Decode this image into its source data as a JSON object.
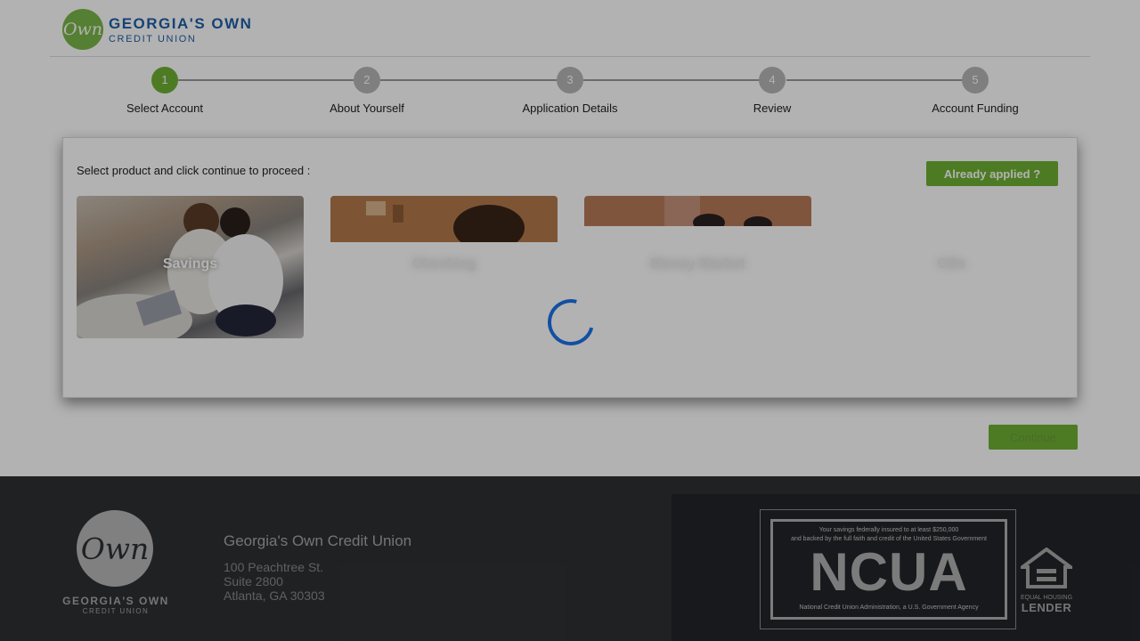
{
  "header": {
    "logo_mark": "Own",
    "logo_line1": "GEORGIA'S OWN",
    "logo_line2": "CREDIT UNION"
  },
  "steps": [
    {
      "num": "1",
      "label": "Select Account",
      "active": true
    },
    {
      "num": "2",
      "label": "About Yourself",
      "active": false
    },
    {
      "num": "3",
      "label": "Application Details",
      "active": false
    },
    {
      "num": "4",
      "label": "Review",
      "active": false
    },
    {
      "num": "5",
      "label": "Account Funding",
      "active": false
    }
  ],
  "panel": {
    "hint": "Select product and click continue to proceed :",
    "already_applied_label": "Already applied ?",
    "products": [
      {
        "label": "Savings"
      },
      {
        "label": "Checking"
      },
      {
        "label": "Money Market"
      },
      {
        "label": "CDs"
      }
    ]
  },
  "continue_label": "Continue",
  "footer": {
    "logo_mark": "Own",
    "logo_line1": "GEORGIA'S OWN",
    "logo_line2": "CREDIT UNION",
    "org_name": "Georgia's Own Credit Union",
    "address_line1": "100 Peachtree St.",
    "address_line2": "Suite 2800",
    "address_line3": "Atlanta, GA 30303",
    "ncua_top_line1": "Your savings federally insured to at least $250,000",
    "ncua_top_line2": "and backed by the full faith and credit of the United States Government",
    "ncua_big": "NCUA",
    "ncua_bottom": "National Credit Union Administration, a U.S. Government Agency",
    "ehl_line1": "EQUAL HOUSING",
    "ehl_line2": "LENDER"
  },
  "colors": {
    "brand_green": "#6fb033",
    "brand_blue": "#1f5fa8",
    "spinner_blue": "#1a73e8",
    "footer_bg": "#2e3033"
  }
}
